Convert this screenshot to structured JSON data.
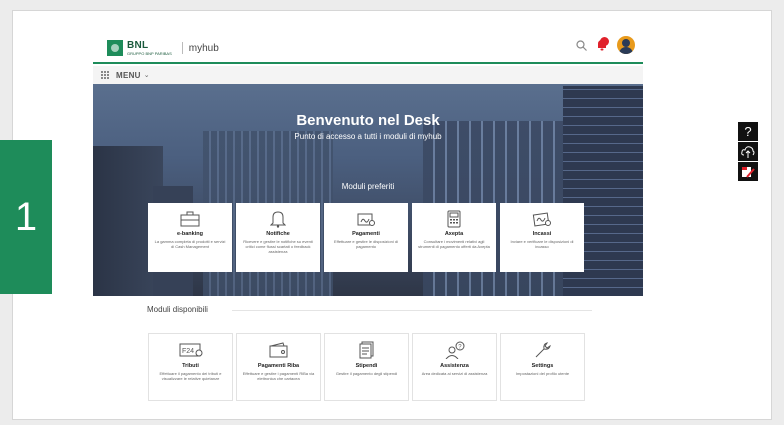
{
  "step_badge": "1",
  "header": {
    "logo_title": "BNL",
    "logo_subtitle": "GRUPPO BNP PARIBAS",
    "app_name": "myhub",
    "notification_count": "",
    "icons": [
      "search-icon",
      "notification-bell-icon",
      "user-avatar-icon"
    ]
  },
  "menu": {
    "label": "MENU",
    "icon": "grid-menu-icon"
  },
  "hero": {
    "title": "Benvenuto nel Desk",
    "subtitle": "Punto di accesso a tutti i moduli di myhub",
    "favorites_label": "Moduli preferiti"
  },
  "favorites": [
    {
      "title": "e-banking",
      "desc": "La gamma completa di prodotti e servizi di Cash Management",
      "icon": "briefcase-icon"
    },
    {
      "title": "Notifiche",
      "desc": "Ricevere e gestire le notifiche su eventi critici come flussi scartati o feedback assistenza",
      "icon": "bell-icon"
    },
    {
      "title": "Pagamenti",
      "desc": "Effettuare e gestire le disposizioni di pagamento",
      "icon": "payment-icon"
    },
    {
      "title": "Axepta",
      "desc": "Consultare i movimenti relativi agli strumenti di pagamento offerti da Axepta",
      "icon": "pos-terminal-icon"
    },
    {
      "title": "Incassi",
      "desc": "Inviare e verificare le disposizioni di incasso",
      "icon": "collection-icon"
    }
  ],
  "modules": {
    "title": "Moduli disponibili",
    "items": [
      {
        "title": "Tributi",
        "desc": "Effettuare il pagamento dei tributi e visualizzare le relative quietanze",
        "icon": "f24-icon",
        "icon_text": "F24"
      },
      {
        "title": "Pagamenti Riba",
        "desc": "Effettuare e gestire i pagamenti RiBa via elettronica che cartacea",
        "icon": "wallet-icon",
        "icon_text": ""
      },
      {
        "title": "Stipendi",
        "desc": "Gestire il pagamento degli stipendi",
        "icon": "salary-doc-icon",
        "icon_text": ""
      },
      {
        "title": "Assistenza",
        "desc": "Area dedicata ai servizi di assistenza",
        "icon": "support-icon",
        "icon_text": ""
      },
      {
        "title": "Settings",
        "desc": "Impostazioni del profilo utente",
        "icon": "wrench-icon",
        "icon_text": ""
      }
    ]
  },
  "side_tools": [
    {
      "icon": "help-icon",
      "glyph": "?"
    },
    {
      "icon": "cloud-upload-icon",
      "glyph": ""
    },
    {
      "icon": "edit-note-icon",
      "glyph": ""
    }
  ],
  "colors": {
    "brand_green": "#1e8c5a",
    "hero_blue": "#4b5f7f",
    "notification_red": "#e0212b"
  }
}
